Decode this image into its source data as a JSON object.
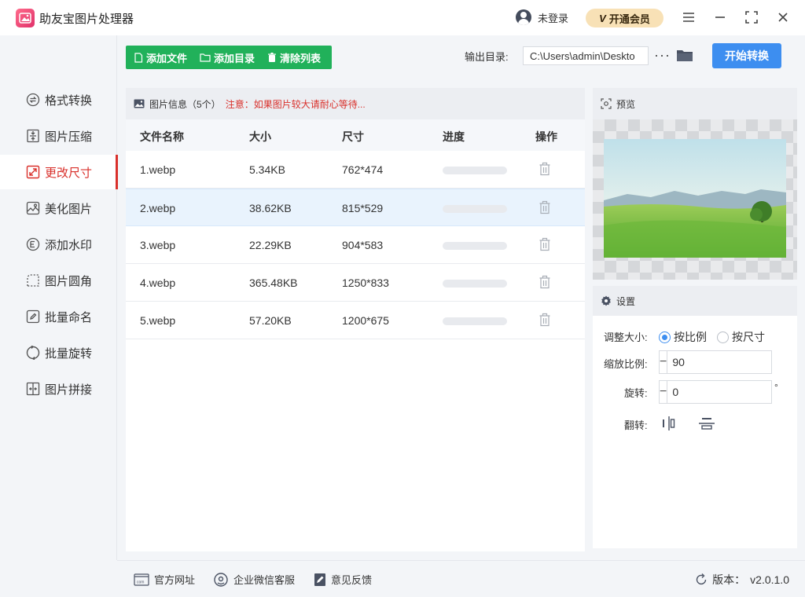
{
  "app": {
    "title": "助友宝图片处理器",
    "login_label": "未登录",
    "vip_label": "开通会员",
    "vip_logo": "V",
    "accent": "#d9302b",
    "primary": "#3d8ef0",
    "green": "#21b15a"
  },
  "sidebar": {
    "items": [
      {
        "label": "格式转换",
        "icon": "convert-icon"
      },
      {
        "label": "图片压缩",
        "icon": "compress-icon"
      },
      {
        "label": "更改尺寸",
        "icon": "resize-icon",
        "active": true
      },
      {
        "label": "美化图片",
        "icon": "beautify-icon"
      },
      {
        "label": "添加水印",
        "icon": "watermark-icon"
      },
      {
        "label": "图片圆角",
        "icon": "rounded-corner-icon"
      },
      {
        "label": "批量命名",
        "icon": "rename-icon"
      },
      {
        "label": "批量旋转",
        "icon": "rotate-icon"
      },
      {
        "label": "图片拼接",
        "icon": "stitch-icon"
      }
    ]
  },
  "toolbar": {
    "add_file": "添加文件",
    "add_folder": "添加目录",
    "clear_list": "清除列表",
    "output_label": "输出目录:",
    "output_path": "C:\\Users\\admin\\Deskto",
    "more": "···",
    "start": "开始转换"
  },
  "file_panel": {
    "info_label": "图片信息（5个）",
    "warning": "注意：如果图片较大请耐心等待...",
    "columns": [
      "文件名称",
      "大小",
      "尺寸",
      "进度",
      "操作"
    ],
    "rows": [
      {
        "name": "1.webp",
        "size": "5.34KB",
        "dims": "762*474",
        "progress": 0
      },
      {
        "name": "2.webp",
        "size": "38.62KB",
        "dims": "815*529",
        "progress": 0,
        "selected": true
      },
      {
        "name": "3.webp",
        "size": "22.29KB",
        "dims": "904*583",
        "progress": 0
      },
      {
        "name": "4.webp",
        "size": "365.48KB",
        "dims": "1250*833",
        "progress": 0
      },
      {
        "name": "5.webp",
        "size": "57.20KB",
        "dims": "1200*675",
        "progress": 0
      }
    ]
  },
  "preview": {
    "title": "预览"
  },
  "settings": {
    "title": "设置",
    "resize_label": "调整大小:",
    "by_ratio": "按比例",
    "by_size": "按尺寸",
    "resize_mode": "by_ratio",
    "scale_label": "缩放比例:",
    "scale_value": "90",
    "rotate_label": "旋转:",
    "rotate_value": "0",
    "degree_symbol": "°",
    "flip_label": "翻转:"
  },
  "footer": {
    "website": "官方网址",
    "wechat": "企业微信客服",
    "feedback": "意见反馈",
    "version_label": "版本：",
    "version": "v2.0.1.0"
  }
}
